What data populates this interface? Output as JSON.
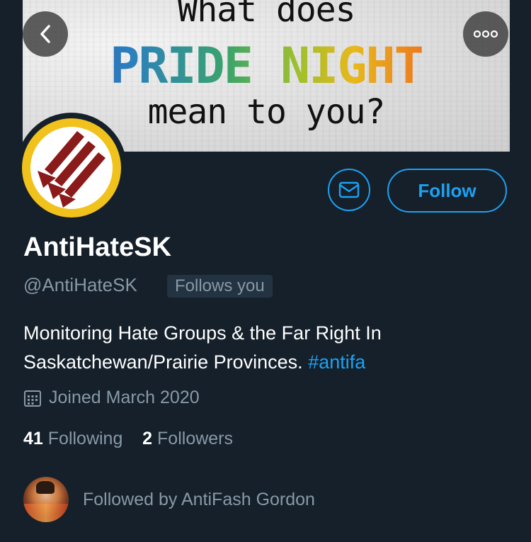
{
  "banner": {
    "line1": "What does",
    "line2": "PRIDE NIGHT",
    "line3": "mean to you?"
  },
  "header": {
    "back_icon": "chevron-left-icon",
    "more_icon": "more-dots-icon"
  },
  "profile": {
    "display_name": "AntiHateSK",
    "handle": "@AntiHateSK",
    "follows_you": "Follows you",
    "bio_text": "Monitoring Hate Groups & the Far Right In Saskatchewan/Prairie Provinces. ",
    "bio_hashtag": "#antifa",
    "joined": "Joined March 2020",
    "following_count": "41",
    "following_label": "Following",
    "followers_count": "2",
    "followers_label": "Followers",
    "followed_by": "Followed by AntiFash Gordon"
  },
  "actions": {
    "follow_label": "Follow",
    "message_icon": "mail-icon"
  },
  "colors": {
    "background": "#15202b",
    "accent": "#1da1f2",
    "secondary_text": "#8899a6",
    "avatar_ring": "#f1c21b",
    "avatar_arrows": "#8b1a1a"
  }
}
